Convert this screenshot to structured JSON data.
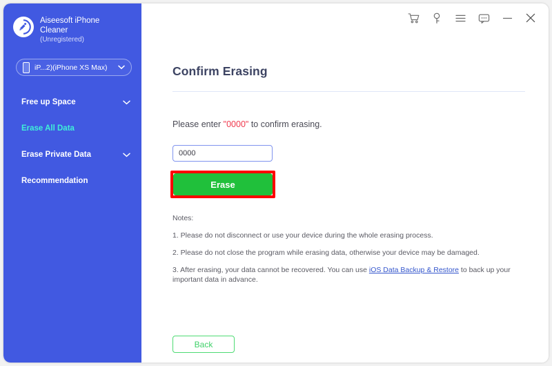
{
  "app": {
    "brand_line1": "Aiseesoft iPhone",
    "brand_line2": "Cleaner",
    "registration_status": "(Unregistered)",
    "logo_icon": "brush-circle-logo",
    "accent_blue": "#4159e1",
    "accent_green": "#20c03b",
    "highlight_red": "#fe0000",
    "active_nav_color": "#3ff0d8"
  },
  "device_selector": {
    "label": "iP...2)(iPhone XS Max)",
    "phone_icon": "phone-icon",
    "chevron_icon": "chevron-down-icon"
  },
  "sidebar": {
    "items": [
      {
        "label": "Free up Space",
        "has_chevron": true,
        "active": false
      },
      {
        "label": "Erase All Data",
        "has_chevron": false,
        "active": true
      },
      {
        "label": "Erase Private Data",
        "has_chevron": true,
        "active": false
      },
      {
        "label": "Recommendation",
        "has_chevron": false,
        "active": false
      }
    ]
  },
  "titlebar": {
    "icons": [
      {
        "name": "cart-icon",
        "glyph": "\u0000"
      },
      {
        "name": "key-icon",
        "glyph": "\u0000"
      },
      {
        "name": "menu-icon",
        "glyph": "\u0000"
      },
      {
        "name": "feedback-icon",
        "glyph": "\u0000"
      },
      {
        "name": "minimize-icon",
        "glyph": "\u0000"
      },
      {
        "name": "close-icon",
        "glyph": "\u0000"
      }
    ]
  },
  "main": {
    "page_title": "Confirm Erasing",
    "prompt_prefix": "Please enter ",
    "prompt_code": "\"0000\"",
    "prompt_suffix": " to confirm erasing.",
    "input_value": "0000",
    "input_placeholder": "0000",
    "erase_label": "Erase",
    "back_label": "Back",
    "notes_heading": "Notes:",
    "notes": [
      {
        "text": "1. Please do not disconnect or use your device during the whole erasing process."
      },
      {
        "text": "2. Please do not close the program while erasing data, otherwise your device may be damaged."
      }
    ],
    "note3_prefix": "3. After erasing, your data cannot be recovered. You can use ",
    "note3_link": "iOS Data Backup & Restore",
    "note3_suffix": " to back up your important data in advance."
  }
}
